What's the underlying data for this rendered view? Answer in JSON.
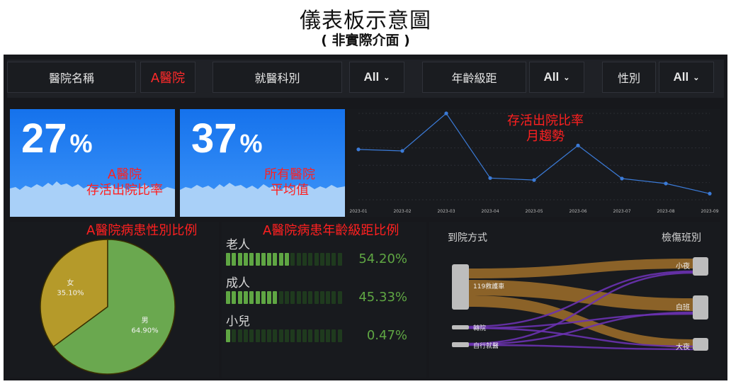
{
  "page": {
    "title": "儀表板示意圖",
    "subtitle": "( 非實際介面 )"
  },
  "filters": {
    "hospital_label": "醫院名稱",
    "hospital_value": "A醫院",
    "dept_label": "就醫科別",
    "dept_value": "All",
    "age_label": "年齡級距",
    "age_value": "All",
    "gender_label": "性別",
    "gender_value": "All"
  },
  "stats": [
    {
      "value": "27",
      "unit": "%",
      "caption_line1": "A醫院",
      "caption_line2": "存活出院比率"
    },
    {
      "value": "37",
      "unit": "%",
      "caption_line1": "所有醫院",
      "caption_line2": "平均值"
    }
  ],
  "trend": {
    "title_line1": "存活出院比率",
    "title_line2": "月趨勢"
  },
  "gender_pie": {
    "title": "A醫院病患性別比例"
  },
  "age_bars": {
    "title": "A醫院病患年齡級距比例",
    "rows": [
      {
        "label": "老人",
        "value": "54.20%",
        "fraction": 0.542
      },
      {
        "label": "成人",
        "value": "45.33%",
        "fraction": 0.4533
      },
      {
        "label": "小兒",
        "value": "0.47%",
        "fraction": 0.0047
      }
    ]
  },
  "sankey": {
    "left_title": "到院方式",
    "right_title": "檢傷班別",
    "sources": [
      "119救護車",
      "轉院",
      "自行就醫"
    ],
    "targets": [
      "小夜",
      "白班",
      "大夜"
    ]
  },
  "colors": {
    "stat_blue": "#1f7cf0",
    "line_blue": "#3b7bd8",
    "pie_female": "#b59a2a",
    "pie_male": "#6aa84f",
    "bar_green": "#5fa643",
    "sankey_orange": "#a0702a",
    "sankey_purple": "#6a32b0",
    "annotation_red": "#ff2020"
  },
  "chart_data": [
    {
      "type": "line",
      "x": [
        "2023-01",
        "2023-02",
        "2023-03",
        "2023-04",
        "2023-05",
        "2023-06",
        "2023-07",
        "2023-08",
        "2023-09"
      ],
      "series": [
        {
          "values": [
            30.4,
            29.8,
            45.0,
            18.8,
            18.0,
            32.0,
            18.6,
            16.6,
            12.5
          ]
        }
      ],
      "ylim": [
        10,
        45
      ]
    },
    {
      "type": "pie",
      "labels": [
        "女",
        "男"
      ],
      "values": [
        35.1,
        64.9
      ],
      "value_labels": [
        "35.10%",
        "64.90%"
      ]
    }
  ]
}
